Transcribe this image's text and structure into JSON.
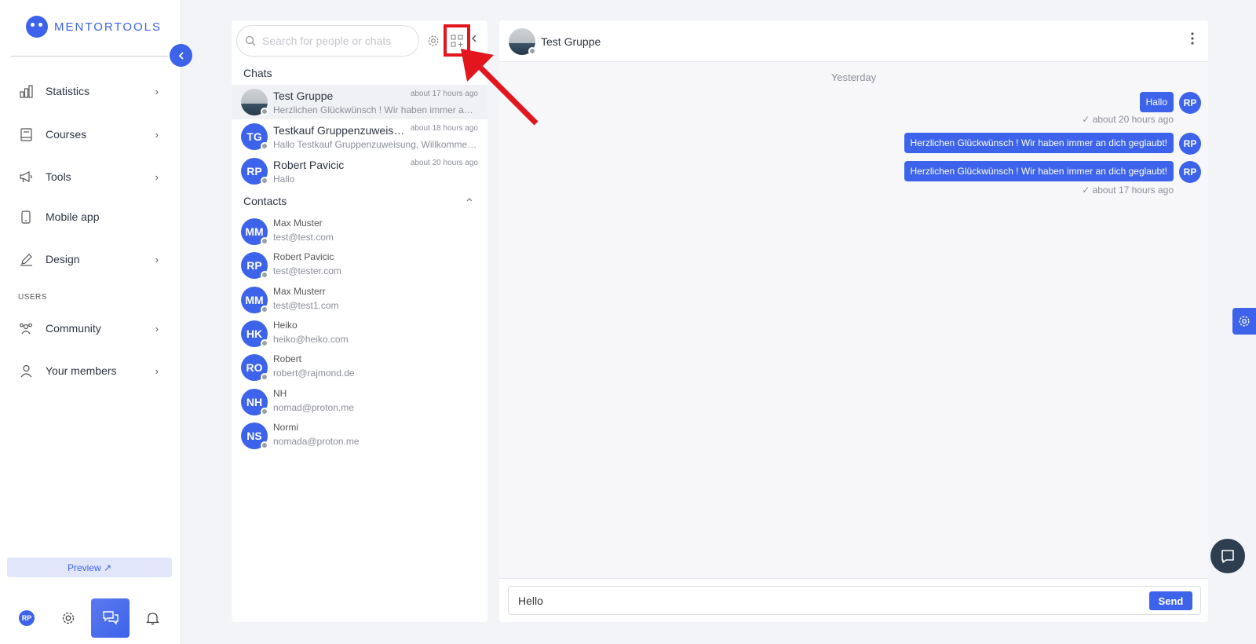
{
  "brand": {
    "name": "MENTORTOOLS",
    "color": "#3d63ea"
  },
  "sidebar": {
    "items": [
      {
        "label": "Statistics",
        "icon": "bar-chart-icon",
        "has_chevron": true
      },
      {
        "label": "Courses",
        "icon": "book-icon",
        "has_chevron": true
      },
      {
        "label": "Tools",
        "icon": "megaphone-icon",
        "has_chevron": true
      },
      {
        "label": "Mobile app",
        "icon": "phone-icon",
        "has_chevron": false
      },
      {
        "label": "Design",
        "icon": "pencil-icon",
        "has_chevron": true
      }
    ],
    "users_section": "USERS",
    "user_items": [
      {
        "label": "Community",
        "icon": "people-icon",
        "has_chevron": true
      },
      {
        "label": "Your members",
        "icon": "person-icon",
        "has_chevron": true
      }
    ],
    "preview_label": "Preview ↗",
    "user_initials": "RP"
  },
  "chat_list": {
    "search_placeholder": "Search for people or chats",
    "chats_heading": "Chats",
    "contacts_heading": "Contacts",
    "chats": [
      {
        "name": "Test Gruppe",
        "time": "about 17 hours ago",
        "preview": "Herzlichen Glückwünsch ! Wir haben immer an dich geglaubt!",
        "initials": "",
        "photo": true,
        "active": true
      },
      {
        "name": "Testkauf Gruppenzuweisung",
        "time": "about 18 hours ago",
        "preview": "Hallo Testkauf Gruppenzuweisung, Willkommen in der Gruppe",
        "initials": "TG",
        "photo": false,
        "active": false
      },
      {
        "name": "Robert Pavicic",
        "time": "about 20 hours ago",
        "preview": "Hallo",
        "initials": "RP",
        "photo": false,
        "active": false
      }
    ],
    "contacts": [
      {
        "name": "Max Muster",
        "email": "test@test.com",
        "initials": "MM"
      },
      {
        "name": "Robert Pavicic",
        "email": "test@tester.com",
        "initials": "RP"
      },
      {
        "name": "Max Musterr",
        "email": "test@test1.com",
        "initials": "MM"
      },
      {
        "name": "Heiko",
        "email": "heiko@heiko.com",
        "initials": "HK"
      },
      {
        "name": "Robert",
        "email": "robert@rajmond.de",
        "initials": "RO"
      },
      {
        "name": "NH",
        "email": "nomad@proton.me",
        "initials": "NH"
      },
      {
        "name": "Normi",
        "email": "nomada@proton.me",
        "initials": "NS"
      }
    ]
  },
  "conversation": {
    "title": "Test Gruppe",
    "day_label": "Yesterday",
    "messages": [
      {
        "text": "Hallo",
        "initials": "RP",
        "time": "about 20 hours ago"
      },
      {
        "text": "Herzlichen Glückwünsch ! Wir haben immer an dich geglaubt!",
        "initials": "RP",
        "time": ""
      },
      {
        "text": "Herzlichen Glückwünsch ! Wir haben immer an dich geglaubt!",
        "initials": "RP",
        "time": "about 17 hours ago"
      }
    ],
    "composer_value": "Hello",
    "send_label": "Send"
  },
  "colors": {
    "accent": "#3d63ea",
    "highlight": "#e3151d",
    "dark_button": "#2d3e50"
  }
}
